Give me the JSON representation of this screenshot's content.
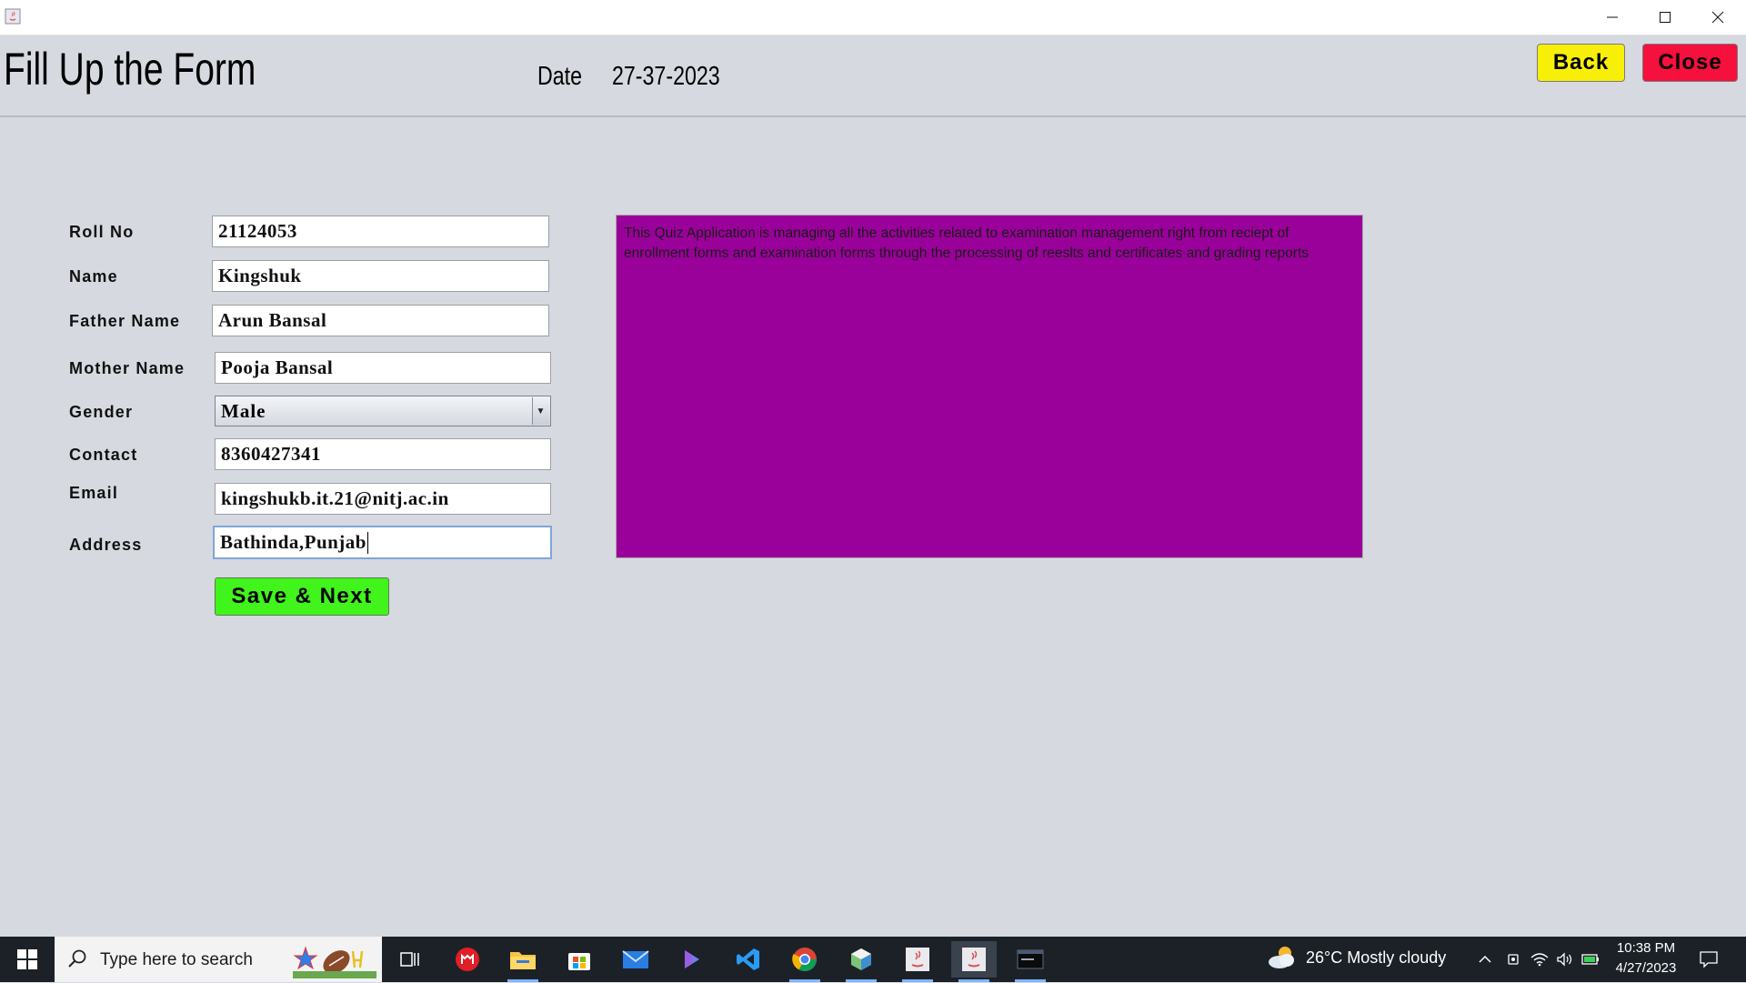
{
  "header": {
    "title": "Fill Up the Form",
    "date_label": "Date",
    "date_value": "27-37-2023",
    "back_label": "Back",
    "close_label": "Close"
  },
  "form": {
    "labels": {
      "roll_no": "Roll No",
      "name": "Name",
      "father_name": "Father Name",
      "mother_name": "Mother Name",
      "gender": "Gender",
      "contact": "Contact",
      "email": "Email",
      "address": "Address"
    },
    "values": {
      "roll_no": "21124053",
      "name": "Kingshuk",
      "father_name": "Arun Bansal",
      "mother_name": "Pooja Bansal",
      "gender": "Male",
      "contact": "8360427341",
      "email": "kingshukb.it.21@nitj.ac.in",
      "address": "Bathinda,Punjab"
    },
    "save_label": "Save & Next"
  },
  "info_panel": {
    "text": "This Quiz Application is managing all the activities related to examination management right from reciept of enrollment forms and examination forms through the processing of reeslts and certificates and grading reports",
    "background": "#9a009a"
  },
  "colors": {
    "back_button": "#f8ef09",
    "close_button": "#f5103d",
    "save_button": "#41f41b",
    "window_bg": "#d6d9e0"
  },
  "taskbar": {
    "search_placeholder": "Type here to search",
    "pinned": [
      "task-view-icon",
      "mcafee-icon",
      "file-explorer-icon",
      "microsoft-store-icon",
      "mail-icon",
      "copilot-icon",
      "vscode-icon",
      "chrome-icon",
      "box-app-icon",
      "java-app-icon",
      "java-app-active-icon",
      "mysql-shell-icon"
    ],
    "weather": "26°C  Mostly cloudy",
    "time": "10:38 PM",
    "date": "4/27/2023"
  }
}
